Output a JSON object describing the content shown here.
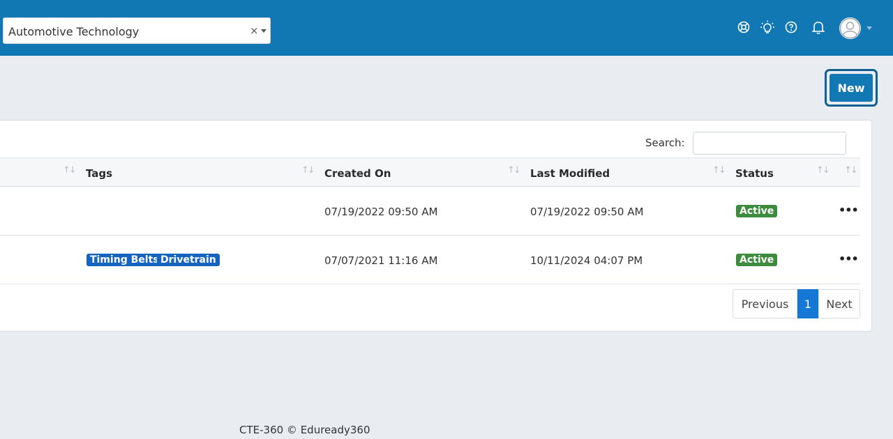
{
  "header": {
    "program_select": {
      "value": "Automotive Technology",
      "clear": "×"
    },
    "icons": [
      "support-icon",
      "lightbulb-icon",
      "help-icon",
      "bell-icon"
    ]
  },
  "toolbar": {
    "new_label": "New"
  },
  "search": {
    "label": "Search:",
    "value": ""
  },
  "table": {
    "columns": [
      "Tags",
      "Created On",
      "Last Modified",
      "Status"
    ],
    "rows": [
      {
        "tags": [],
        "created": "07/19/2022 09:50 AM",
        "modified": "07/19/2022 09:50 AM",
        "status": "Active",
        "actions": "•••"
      },
      {
        "tags": [
          "Timing Belts",
          "Drivetrain"
        ],
        "created": "07/07/2021 11:16 AM",
        "modified": "10/11/2024 04:07 PM",
        "status": "Active",
        "actions": "•••"
      }
    ]
  },
  "pagination": {
    "previous": "Previous",
    "page": "1",
    "next": "Next"
  },
  "footer": {
    "text": "CTE-360 © Eduready360"
  },
  "colors": {
    "header": "#1278b4",
    "active_badge": "#3d8b3d",
    "tag": "#1565c0",
    "page_active": "#1478d4"
  }
}
